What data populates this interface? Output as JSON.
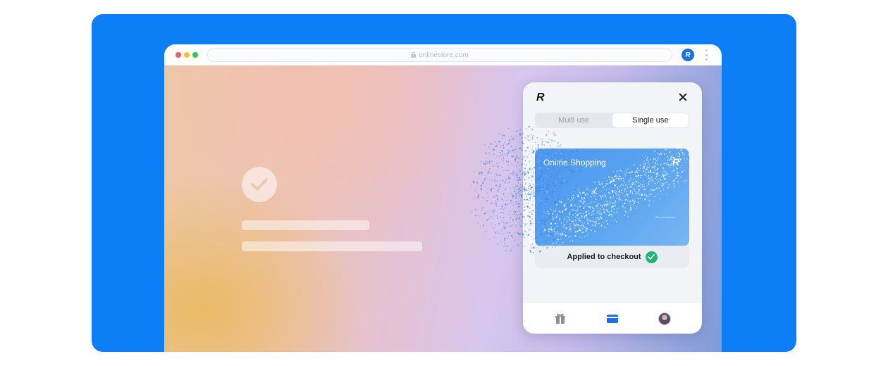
{
  "browser": {
    "url": "onlinestore.com",
    "extension_icon": "revolut-logo-icon",
    "menu_icon": "kebab-menu-icon"
  },
  "page": {
    "confirmation_icon": "check-icon"
  },
  "popup": {
    "logo": "R",
    "close_icon": "close-icon",
    "tabs": [
      {
        "label": "Multi use",
        "active": false
      },
      {
        "label": "Single use",
        "active": true
      }
    ],
    "card": {
      "title": "Online Shopping",
      "logo": "R",
      "masked_number": "* *",
      "holder": "Henry Anderson"
    },
    "status": {
      "text": "Applied to checkout",
      "icon": "check-circle-icon",
      "color": "#21b677"
    },
    "nav": [
      {
        "icon": "gift-icon"
      },
      {
        "icon": "card-icon",
        "active": true
      },
      {
        "icon": "avatar-icon"
      }
    ]
  },
  "colors": {
    "background": "#0d7ff6",
    "accent": "#1b6fe8",
    "card": "#4b96ee"
  }
}
